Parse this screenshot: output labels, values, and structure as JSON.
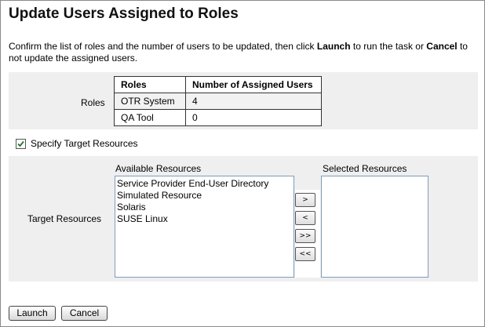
{
  "page": {
    "title": "Update Users Assigned to Roles",
    "instructions": {
      "part1": "Confirm the list of roles and the number of users to be updated, then click ",
      "launch_word": "Launch",
      "part2": " to run the task or ",
      "cancel_word": "Cancel",
      "part3": " to not update the assigned users."
    }
  },
  "roles": {
    "label": "Roles",
    "headers": [
      "Roles",
      "Number of Assigned Users"
    ],
    "rows": [
      {
        "role": "OTR System",
        "count": "4"
      },
      {
        "role": "QA Tool",
        "count": "0"
      }
    ]
  },
  "specify_target": {
    "label": "Specify Target Resources",
    "checked": true
  },
  "target_resources": {
    "label": "Target Resources",
    "available_title": "Available Resources",
    "selected_title": "Selected Resources",
    "available": [
      "Service Provider End-User Directory",
      "Simulated Resource",
      "Solaris",
      "SUSE Linux"
    ],
    "selected": [],
    "buttons": {
      "add": ">",
      "remove": "<",
      "add_all": ">>",
      "remove_all": "<<"
    }
  },
  "actions": {
    "launch": "Launch",
    "cancel": "Cancel"
  }
}
